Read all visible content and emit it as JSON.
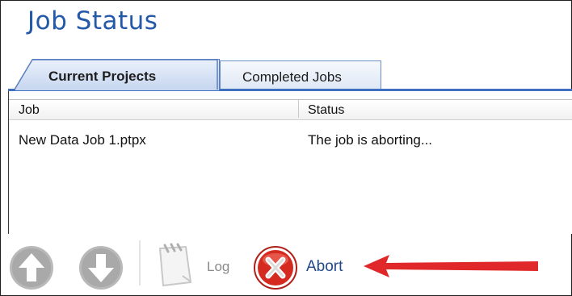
{
  "window": {
    "title": "Job Status"
  },
  "tabs": [
    {
      "label": "Current Projects",
      "active": true
    },
    {
      "label": "Completed Jobs",
      "active": false
    }
  ],
  "table": {
    "columns": [
      "Job",
      "Status"
    ],
    "rows": [
      {
        "job": "New Data Job 1.ptpx",
        "status": "The job is aborting..."
      }
    ]
  },
  "toolbar": {
    "move_up_icon": "arrow-up-circle-icon",
    "move_down_icon": "arrow-down-circle-icon",
    "log_icon": "notepad-icon",
    "log_label": "Log",
    "abort_icon": "red-x-circle-icon",
    "abort_label": "Abort"
  },
  "colors": {
    "title": "#2458a8",
    "tab_accent": "#3f6fbf",
    "abort_red": "#d42a20",
    "annotation_arrow": "#e0282a"
  }
}
